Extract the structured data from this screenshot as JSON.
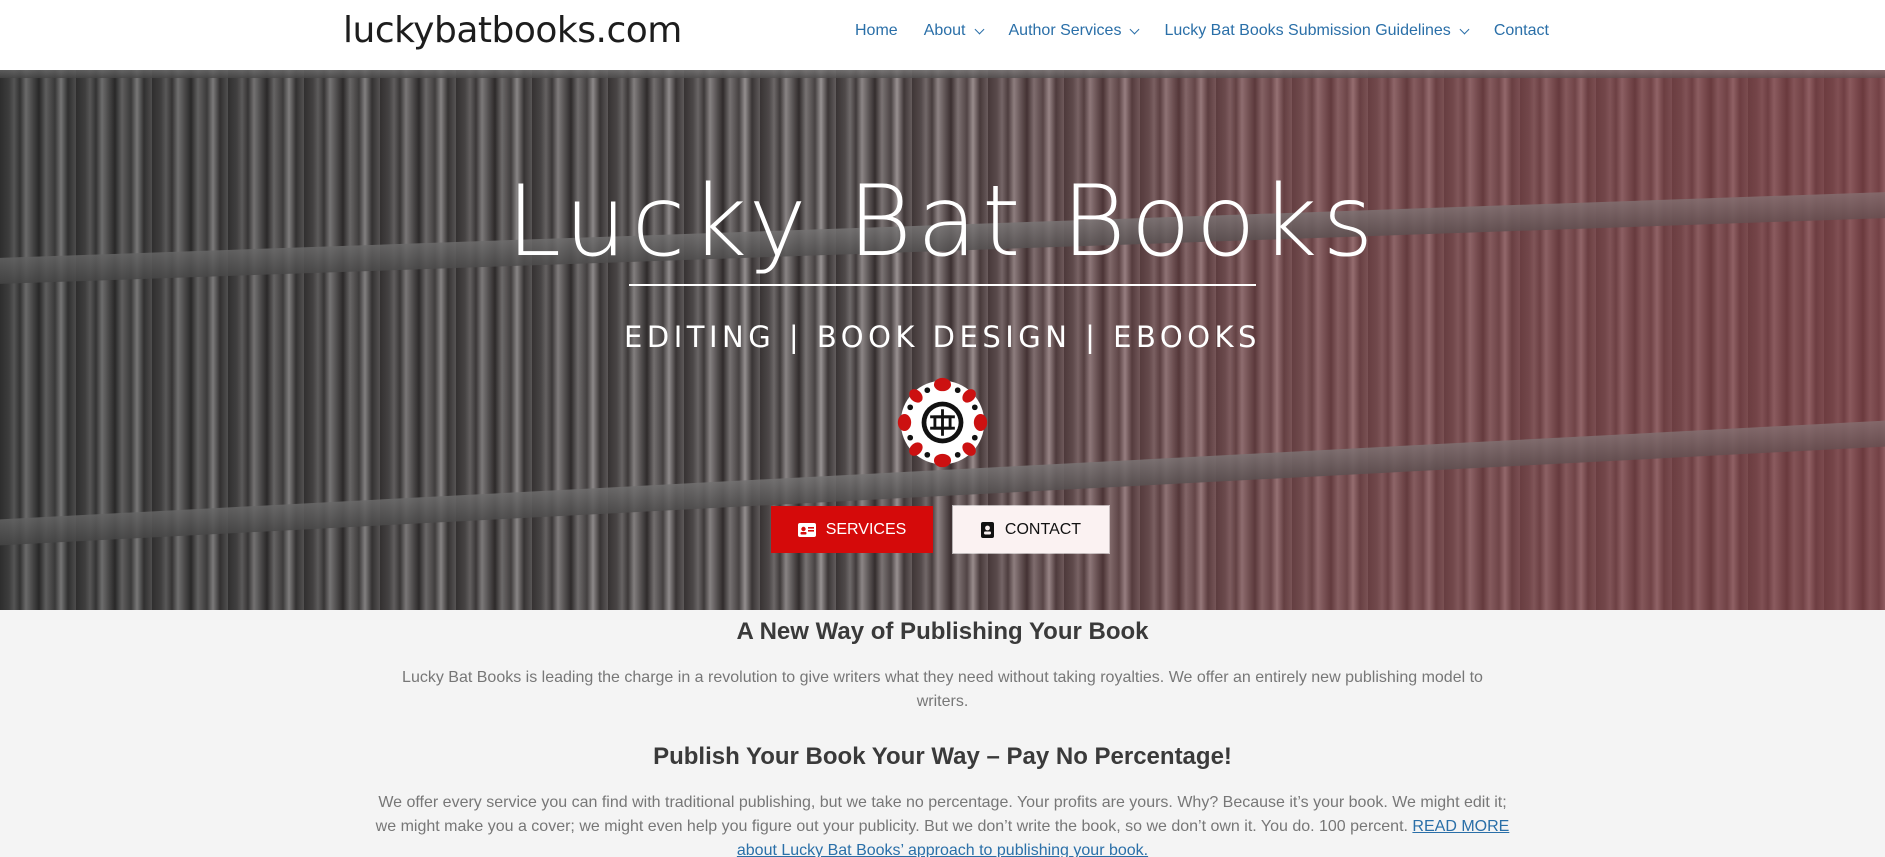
{
  "header": {
    "site_title": "luckybatbooks.com",
    "nav": [
      {
        "label": "Home",
        "has_dropdown": false
      },
      {
        "label": "About",
        "has_dropdown": true
      },
      {
        "label": "Author Services",
        "has_dropdown": true
      },
      {
        "label": "Lucky Bat Books Submission Guidelines",
        "has_dropdown": true
      },
      {
        "label": "Contact",
        "has_dropdown": false
      }
    ]
  },
  "hero": {
    "title": "Lucky Bat Books",
    "subtitle": "EDITING | BOOK DESIGN | EBOOKS",
    "logo_icon": "lucky-bat-logo-icon",
    "buttons": {
      "services": {
        "label": "SERVICES",
        "icon": "id-card-icon"
      },
      "contact": {
        "label": "CONTACT",
        "icon": "contact-book-icon"
      }
    },
    "accent_color": "#d50a0a"
  },
  "main": {
    "heading_1": "A New Way of Publishing Your Book",
    "paragraph_1": "Lucky Bat Books is leading the charge in a revolution to give writers what they need without taking royalties. We offer an entirely new publishing model to writers.",
    "heading_2": "Publish Your Book Your Way – Pay No Percentage!",
    "paragraph_2": "We offer every service you can find with traditional publishing, but we take no percentage. Your profits are yours. Why? Because it’s your book. We might edit it; we might make you a cover; we might even help you figure out your publicity. But we don’t write the book, so we don’t own it. You do. 100 percent.",
    "read_more_link": "READ MORE about Lucky Bat Books’ approach to publishing your book."
  }
}
